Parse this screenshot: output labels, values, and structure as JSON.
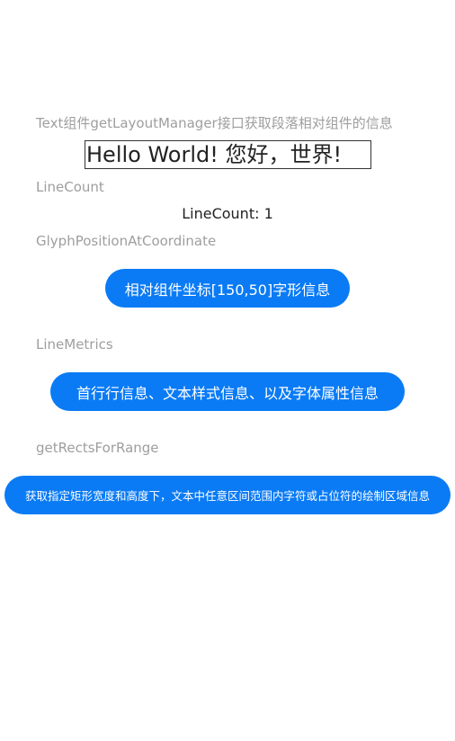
{
  "captions": {
    "section_title": "Text组件getLayoutManager接口获取段落相对组件的信息",
    "line_count": "LineCount",
    "glyph_position": "GlyphPositionAtCoordinate",
    "line_metrics": "LineMetrics",
    "rects_for_range": "getRectsForRange"
  },
  "sample_text": "Hello World! 您好，世界!",
  "line_count_value": "LineCount: 1",
  "buttons": {
    "glyph_position": "相对组件坐标[150,50]字形信息",
    "line_metrics": "首行行信息、文本样式信息、以及字体属性信息",
    "rects_for_range": "获取指定矩形宽度和高度下，文本中任意区间范围内字符或占位符的绘制区域信息"
  },
  "colors": {
    "button_bg": "#0a7bf5",
    "caption_gray": "#9e9e9e"
  }
}
